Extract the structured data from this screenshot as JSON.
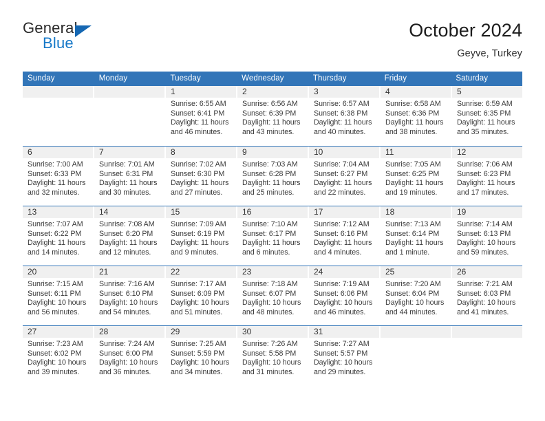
{
  "brand": {
    "name_top": "General",
    "name_bottom": "Blue",
    "accent_color": "#1678c8",
    "triangle_color": "#1567b2"
  },
  "header": {
    "title": "October 2024",
    "subtitle": "Geyve, Turkey"
  },
  "theme": {
    "header_bar_color": "#3275b8",
    "date_band_color": "#f0f0f0",
    "text_color": "#3a3a3a"
  },
  "weekdays": [
    "Sunday",
    "Monday",
    "Tuesday",
    "Wednesday",
    "Thursday",
    "Friday",
    "Saturday"
  ],
  "weeks": [
    [
      {
        "date": "",
        "lines": []
      },
      {
        "date": "",
        "lines": []
      },
      {
        "date": "1",
        "lines": [
          "Sunrise: 6:55 AM",
          "Sunset: 6:41 PM",
          "Daylight: 11 hours",
          "and 46 minutes."
        ]
      },
      {
        "date": "2",
        "lines": [
          "Sunrise: 6:56 AM",
          "Sunset: 6:39 PM",
          "Daylight: 11 hours",
          "and 43 minutes."
        ]
      },
      {
        "date": "3",
        "lines": [
          "Sunrise: 6:57 AM",
          "Sunset: 6:38 PM",
          "Daylight: 11 hours",
          "and 40 minutes."
        ]
      },
      {
        "date": "4",
        "lines": [
          "Sunrise: 6:58 AM",
          "Sunset: 6:36 PM",
          "Daylight: 11 hours",
          "and 38 minutes."
        ]
      },
      {
        "date": "5",
        "lines": [
          "Sunrise: 6:59 AM",
          "Sunset: 6:35 PM",
          "Daylight: 11 hours",
          "and 35 minutes."
        ]
      }
    ],
    [
      {
        "date": "6",
        "lines": [
          "Sunrise: 7:00 AM",
          "Sunset: 6:33 PM",
          "Daylight: 11 hours",
          "and 32 minutes."
        ]
      },
      {
        "date": "7",
        "lines": [
          "Sunrise: 7:01 AM",
          "Sunset: 6:31 PM",
          "Daylight: 11 hours",
          "and 30 minutes."
        ]
      },
      {
        "date": "8",
        "lines": [
          "Sunrise: 7:02 AM",
          "Sunset: 6:30 PM",
          "Daylight: 11 hours",
          "and 27 minutes."
        ]
      },
      {
        "date": "9",
        "lines": [
          "Sunrise: 7:03 AM",
          "Sunset: 6:28 PM",
          "Daylight: 11 hours",
          "and 25 minutes."
        ]
      },
      {
        "date": "10",
        "lines": [
          "Sunrise: 7:04 AM",
          "Sunset: 6:27 PM",
          "Daylight: 11 hours",
          "and 22 minutes."
        ]
      },
      {
        "date": "11",
        "lines": [
          "Sunrise: 7:05 AM",
          "Sunset: 6:25 PM",
          "Daylight: 11 hours",
          "and 19 minutes."
        ]
      },
      {
        "date": "12",
        "lines": [
          "Sunrise: 7:06 AM",
          "Sunset: 6:23 PM",
          "Daylight: 11 hours",
          "and 17 minutes."
        ]
      }
    ],
    [
      {
        "date": "13",
        "lines": [
          "Sunrise: 7:07 AM",
          "Sunset: 6:22 PM",
          "Daylight: 11 hours",
          "and 14 minutes."
        ]
      },
      {
        "date": "14",
        "lines": [
          "Sunrise: 7:08 AM",
          "Sunset: 6:20 PM",
          "Daylight: 11 hours",
          "and 12 minutes."
        ]
      },
      {
        "date": "15",
        "lines": [
          "Sunrise: 7:09 AM",
          "Sunset: 6:19 PM",
          "Daylight: 11 hours",
          "and 9 minutes."
        ]
      },
      {
        "date": "16",
        "lines": [
          "Sunrise: 7:10 AM",
          "Sunset: 6:17 PM",
          "Daylight: 11 hours",
          "and 6 minutes."
        ]
      },
      {
        "date": "17",
        "lines": [
          "Sunrise: 7:12 AM",
          "Sunset: 6:16 PM",
          "Daylight: 11 hours",
          "and 4 minutes."
        ]
      },
      {
        "date": "18",
        "lines": [
          "Sunrise: 7:13 AM",
          "Sunset: 6:14 PM",
          "Daylight: 11 hours",
          "and 1 minute."
        ]
      },
      {
        "date": "19",
        "lines": [
          "Sunrise: 7:14 AM",
          "Sunset: 6:13 PM",
          "Daylight: 10 hours",
          "and 59 minutes."
        ]
      }
    ],
    [
      {
        "date": "20",
        "lines": [
          "Sunrise: 7:15 AM",
          "Sunset: 6:11 PM",
          "Daylight: 10 hours",
          "and 56 minutes."
        ]
      },
      {
        "date": "21",
        "lines": [
          "Sunrise: 7:16 AM",
          "Sunset: 6:10 PM",
          "Daylight: 10 hours",
          "and 54 minutes."
        ]
      },
      {
        "date": "22",
        "lines": [
          "Sunrise: 7:17 AM",
          "Sunset: 6:09 PM",
          "Daylight: 10 hours",
          "and 51 minutes."
        ]
      },
      {
        "date": "23",
        "lines": [
          "Sunrise: 7:18 AM",
          "Sunset: 6:07 PM",
          "Daylight: 10 hours",
          "and 48 minutes."
        ]
      },
      {
        "date": "24",
        "lines": [
          "Sunrise: 7:19 AM",
          "Sunset: 6:06 PM",
          "Daylight: 10 hours",
          "and 46 minutes."
        ]
      },
      {
        "date": "25",
        "lines": [
          "Sunrise: 7:20 AM",
          "Sunset: 6:04 PM",
          "Daylight: 10 hours",
          "and 44 minutes."
        ]
      },
      {
        "date": "26",
        "lines": [
          "Sunrise: 7:21 AM",
          "Sunset: 6:03 PM",
          "Daylight: 10 hours",
          "and 41 minutes."
        ]
      }
    ],
    [
      {
        "date": "27",
        "lines": [
          "Sunrise: 7:23 AM",
          "Sunset: 6:02 PM",
          "Daylight: 10 hours",
          "and 39 minutes."
        ]
      },
      {
        "date": "28",
        "lines": [
          "Sunrise: 7:24 AM",
          "Sunset: 6:00 PM",
          "Daylight: 10 hours",
          "and 36 minutes."
        ]
      },
      {
        "date": "29",
        "lines": [
          "Sunrise: 7:25 AM",
          "Sunset: 5:59 PM",
          "Daylight: 10 hours",
          "and 34 minutes."
        ]
      },
      {
        "date": "30",
        "lines": [
          "Sunrise: 7:26 AM",
          "Sunset: 5:58 PM",
          "Daylight: 10 hours",
          "and 31 minutes."
        ]
      },
      {
        "date": "31",
        "lines": [
          "Sunrise: 7:27 AM",
          "Sunset: 5:57 PM",
          "Daylight: 10 hours",
          "and 29 minutes."
        ]
      },
      {
        "date": "",
        "lines": []
      },
      {
        "date": "",
        "lines": []
      }
    ]
  ]
}
